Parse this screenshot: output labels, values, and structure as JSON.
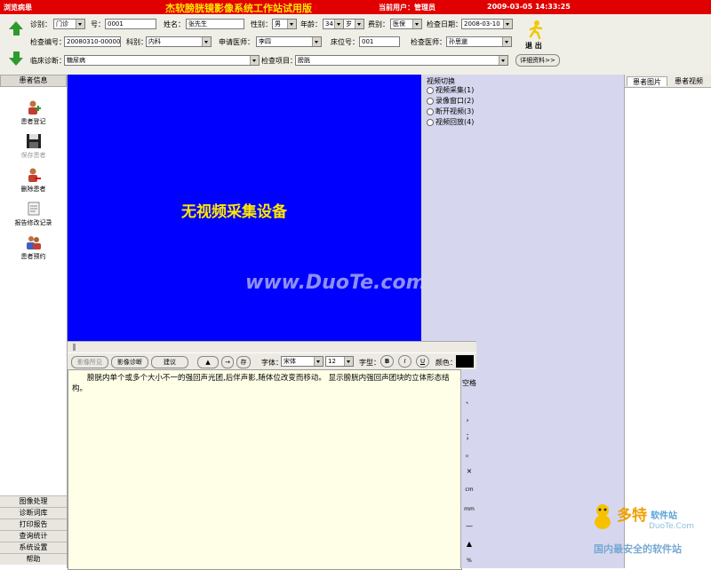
{
  "title": {
    "left": "浏览病患",
    "app": "杰软膀胱镜影像系统工作站试用版",
    "current_user": "当前用户：管理员",
    "datetime": "2009-03-05  14:33:25"
  },
  "form": {
    "visit_label": "诊别：",
    "visit_value": "门诊",
    "no_label": "号：",
    "no_value": "0001",
    "name_label": "姓名：",
    "name_value": "张先生",
    "sex_label": "性别：",
    "sex_value": "男",
    "age_label": "年龄：",
    "age_value": "34",
    "age_unit": "岁",
    "fee_label": "费别：",
    "fee_value": "医保",
    "date_label": "检查日期：",
    "date_value": "2008-03-10",
    "exam_no_label": "检查编号：",
    "exam_no_value": "20080310-000001",
    "dept_label": "科别：",
    "dept_value": "内科",
    "req_doc_label": "申请医师：",
    "req_doc_value": "李四",
    "bed_label": "床位号：",
    "bed_value": "001",
    "exam_doc_label": "检查医师：",
    "exam_doc_value": "孙思邈",
    "diag_label": "临床诊断：",
    "diag_value": "糖尿病",
    "item_label": "检查项目：",
    "item_value": "膀胱",
    "detail_button": "详细资料>>",
    "exit_label": "退 出"
  },
  "left": {
    "header": "患者信息",
    "items": [
      "患者登记",
      "保存患者",
      "删除患者",
      "报告修改记录",
      "患者预约"
    ],
    "bottom": [
      "图像处理",
      "诊断词库",
      "打印报告",
      "查询统计",
      "系统设置",
      "帮助"
    ]
  },
  "video": {
    "message": "无视频采集设备",
    "switch_title": "视频切换",
    "options": [
      "视频采集(1)",
      "录像窗口(2)",
      "断开视频(3)",
      "视频回放(4)"
    ]
  },
  "toolbar": {
    "b1": "影像所见",
    "b2": "影像诊断",
    "b3": "建议",
    "up": "▲",
    "right": "→",
    "save": "存",
    "font_label": "字体：",
    "font_value": "宋体",
    "size_value": "12",
    "style_label": "字型：",
    "bold": "B",
    "italic": "I",
    "underline": "U",
    "color_label": "颜色："
  },
  "report_text": "　　膀胱内单个或多个大小不一的强回声光团,后伴声影,随体位改变而移动。 显示膀胱内强回声团块的立体形态结构。",
  "symbols": [
    "空格",
    "、",
    "，",
    "；",
    "。",
    "×",
    "cm",
    "mm",
    "—",
    "▲",
    "%"
  ],
  "right": {
    "tab1": "患者图片",
    "tab2": "患者视频"
  },
  "watermark": "www.DuoTe.com",
  "logo": {
    "main": "多特",
    "sub": "软件站",
    "url": "DuoTe.Com",
    "slogan": "国内最安全的软件站"
  },
  "colors": {
    "titlebar": "#e00000",
    "title_text": "#ffe600",
    "video_bg": "#0000ff",
    "video_text": "#ffe600",
    "panel_bg": "#d6d7ee"
  }
}
